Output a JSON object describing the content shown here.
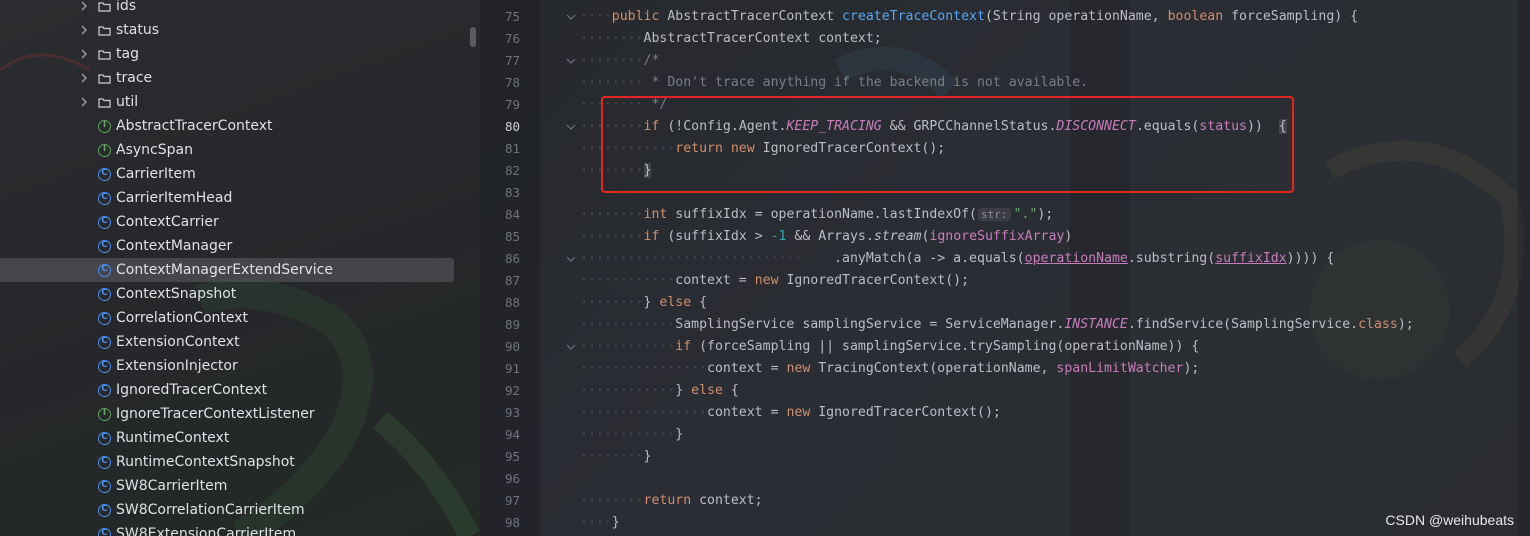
{
  "project_tree": {
    "partial_top_label": "ids",
    "folders": [
      "status",
      "tag",
      "trace",
      "util"
    ],
    "files": [
      {
        "name": "AbstractTracerContext",
        "kind": "interface"
      },
      {
        "name": "AsyncSpan",
        "kind": "interface"
      },
      {
        "name": "CarrierItem",
        "kind": "class"
      },
      {
        "name": "CarrierItemHead",
        "kind": "class"
      },
      {
        "name": "ContextCarrier",
        "kind": "class"
      },
      {
        "name": "ContextManager",
        "kind": "class"
      },
      {
        "name": "ContextManagerExtendService",
        "kind": "class",
        "selected": true
      },
      {
        "name": "ContextSnapshot",
        "kind": "class"
      },
      {
        "name": "CorrelationContext",
        "kind": "class"
      },
      {
        "name": "ExtensionContext",
        "kind": "class"
      },
      {
        "name": "ExtensionInjector",
        "kind": "class"
      },
      {
        "name": "IgnoredTracerContext",
        "kind": "class"
      },
      {
        "name": "IgnoreTracerContextListener",
        "kind": "interface"
      },
      {
        "name": "RuntimeContext",
        "kind": "class"
      },
      {
        "name": "RuntimeContextSnapshot",
        "kind": "class"
      },
      {
        "name": "SW8CarrierItem",
        "kind": "class"
      },
      {
        "name": "SW8CorrelationCarrierItem",
        "kind": "class"
      },
      {
        "name": "SW8ExtensionCarrierItem",
        "kind": "class"
      }
    ]
  },
  "editor": {
    "current_line": "80",
    "inlay_hint": "str:",
    "lines": [
      {
        "n": "75",
        "fold": true,
        "indent": 1,
        "t": [
          [
            "kw",
            "public "
          ],
          [
            "",
            "AbstractTracerContext "
          ],
          [
            "fn",
            "createTraceContext"
          ],
          [
            "",
            "(String operationName, "
          ],
          [
            "kw",
            "boolean "
          ],
          [
            "",
            "forceSampling) {"
          ]
        ]
      },
      {
        "n": "76",
        "indent": 2,
        "t": [
          [
            "",
            "AbstractTracerContext context;"
          ]
        ]
      },
      {
        "n": "77",
        "fold": true,
        "indent": 2,
        "t": [
          [
            "cm",
            "/*"
          ]
        ]
      },
      {
        "n": "78",
        "indent": 2,
        "t": [
          [
            "cm",
            " * Don't trace anything if the backend is not available."
          ]
        ]
      },
      {
        "n": "79",
        "indent": 2,
        "t": [
          [
            "cm",
            " */"
          ]
        ]
      },
      {
        "n": "80",
        "fold": true,
        "indent": 2,
        "t": [
          [
            "kw",
            "if "
          ],
          [
            "",
            "(!Config.Agent."
          ],
          [
            "cnst",
            "KEEP_TRACING"
          ],
          [
            "",
            " && GRPCChannelStatus."
          ],
          [
            "cnst",
            "DISCONNECT"
          ],
          [
            "",
            ".equals("
          ],
          [
            "fld",
            "status"
          ],
          [
            "",
            "))"
          ],
          [
            "",
            "  "
          ],
          [
            "brace",
            "{"
          ]
        ]
      },
      {
        "n": "81",
        "indent": 3,
        "t": [
          [
            "kw",
            "return new "
          ],
          [
            "",
            "IgnoredTracerContext();"
          ]
        ]
      },
      {
        "n": "82",
        "indent": 2,
        "t": [
          [
            "brace",
            "}"
          ]
        ]
      },
      {
        "n": "83",
        "indent": 0,
        "t": []
      },
      {
        "n": "84",
        "indent": 2,
        "t": [
          [
            "kw",
            "int "
          ],
          [
            "",
            "suffixIdx = operationName.lastIndexOf("
          ],
          [
            "hint",
            "str:"
          ],
          [
            "st",
            "\".\""
          ],
          [
            "",
            ");"
          ]
        ]
      },
      {
        "n": "85",
        "indent": 2,
        "t": [
          [
            "kw",
            "if "
          ],
          [
            "",
            "(suffixIdx > "
          ],
          [
            "num",
            "-1"
          ],
          [
            "",
            " && Arrays."
          ],
          [
            "it",
            "stream"
          ],
          [
            "",
            "("
          ],
          [
            "fld",
            "ignoreSuffixArray"
          ],
          [
            "",
            ")"
          ]
        ]
      },
      {
        "n": "86",
        "fold": true,
        "indent": 7,
        "t": [
          [
            "",
            "    .anyMatch(a -> a.equals("
          ],
          [
            "pmu",
            "operationName"
          ],
          [
            "",
            ".substring("
          ],
          [
            "pmu",
            "suffixIdx"
          ],
          [
            "",
            ")))) {"
          ]
        ]
      },
      {
        "n": "87",
        "indent": 3,
        "t": [
          [
            "",
            "context = "
          ],
          [
            "kw",
            "new "
          ],
          [
            "",
            "IgnoredTracerContext();"
          ]
        ]
      },
      {
        "n": "88",
        "indent": 2,
        "t": [
          [
            "",
            "} "
          ],
          [
            "kw",
            "else "
          ],
          [
            "",
            "{"
          ]
        ]
      },
      {
        "n": "89",
        "indent": 3,
        "t": [
          [
            "",
            "SamplingService samplingService = ServiceManager."
          ],
          [
            "cnst",
            "INSTANCE"
          ],
          [
            "",
            ".findService(SamplingService."
          ],
          [
            "kw",
            "class"
          ],
          [
            "",
            ");"
          ]
        ]
      },
      {
        "n": "90",
        "fold": true,
        "indent": 3,
        "t": [
          [
            "kw",
            "if "
          ],
          [
            "",
            "(forceSampling || samplingService.trySampling(operationName)) {"
          ]
        ]
      },
      {
        "n": "91",
        "indent": 4,
        "t": [
          [
            "",
            "context = "
          ],
          [
            "kw",
            "new "
          ],
          [
            "",
            "TracingContext(operationName, "
          ],
          [
            "fld",
            "spanLimitWatcher"
          ],
          [
            "",
            ");"
          ]
        ]
      },
      {
        "n": "92",
        "indent": 3,
        "t": [
          [
            "",
            "} "
          ],
          [
            "kw",
            "else "
          ],
          [
            "",
            "{"
          ]
        ]
      },
      {
        "n": "93",
        "indent": 4,
        "t": [
          [
            "",
            "context = "
          ],
          [
            "kw",
            "new "
          ],
          [
            "",
            "IgnoredTracerContext();"
          ]
        ]
      },
      {
        "n": "94",
        "indent": 3,
        "t": [
          [
            "",
            "}"
          ]
        ]
      },
      {
        "n": "95",
        "indent": 2,
        "t": [
          [
            "",
            "}"
          ]
        ]
      },
      {
        "n": "96",
        "indent": 0,
        "t": []
      },
      {
        "n": "97",
        "indent": 2,
        "t": [
          [
            "kw",
            "return "
          ],
          [
            "",
            "context;"
          ]
        ]
      },
      {
        "n": "98",
        "indent": 1,
        "t": [
          [
            "",
            "}"
          ]
        ]
      }
    ]
  },
  "watermark": "CSDN @weihubeats",
  "colors": {
    "highlight_box": "#e3261f",
    "keyword": "#cf8e6d",
    "method": "#56a8f5",
    "comment": "#7a7e85",
    "string": "#6aab73",
    "constant": "#c77dbb",
    "class_icon": "#4b8ff0",
    "interface_icon": "#5fa55b"
  }
}
